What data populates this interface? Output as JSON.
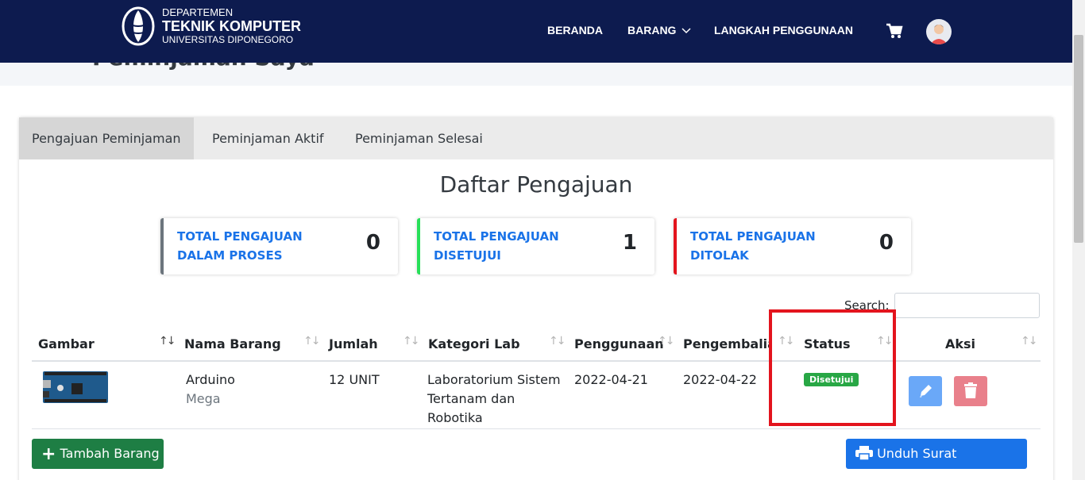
{
  "header": {
    "brand_line1": "DEPARTEMEN",
    "brand_line2": "TEKNIK KOMPUTER",
    "brand_line3": "UNIVERSITAS DIPONEGORO",
    "nav": [
      "BERANDA",
      "BARANG",
      "LANGKAH PENGGUNAAN"
    ],
    "cart_icon": "shopping-cart-icon",
    "avatar_icon": "user-avatar-icon",
    "bg_color": "#0d1b4f"
  },
  "page": {
    "title": "Peminjaman Saya",
    "crumb_fragment": "/"
  },
  "tabs": [
    "Pengajuan Peminjaman",
    "Peminjaman Aktif",
    "Peminjaman Selesai"
  ],
  "active_tab": "Pengajuan Peminjaman",
  "list_title": "Daftar Pengajuan",
  "info_boxes": [
    {
      "label": "TOTAL PENGAJUAN DALAM PROSES",
      "value": "0",
      "color": "#6c757d"
    },
    {
      "label": "TOTAL PENGAJUAN DISETUJUI",
      "value": "1",
      "color": "#28e05a"
    },
    {
      "label": "TOTAL PENGAJUAN DITOLAK",
      "value": "0",
      "color": "#e3141d"
    }
  ],
  "search": {
    "label": "Search:",
    "value": ""
  },
  "table": {
    "headers": [
      "Gambar",
      "Nama Barang",
      "Jumlah",
      "Kategori Lab",
      "Penggunaan",
      "Pengembalian",
      "Status",
      "Aksi"
    ],
    "rows": [
      {
        "nama_line1": "Arduino",
        "nama_line2": "Mega",
        "jumlah": "12 UNIT",
        "kategori_line1": "Laboratorium Sistem",
        "kategori_line2": "Tertanam dan",
        "kategori_line3": "Robotika",
        "penggunaan": "2022-04-21",
        "pengembalian": "2022-04-22",
        "status": "Disetujui"
      }
    ]
  },
  "buttons": {
    "add": "Tambah Barang",
    "print": "Unduh Surat Pengajuan"
  },
  "colors": {
    "status_approved": "#28a745",
    "edit_button": "#6aa8f8",
    "delete_button": "#e9808b",
    "add_button": "#1e7e44",
    "print_button": "#1a73e8",
    "highlight_box": "#e3141d"
  }
}
